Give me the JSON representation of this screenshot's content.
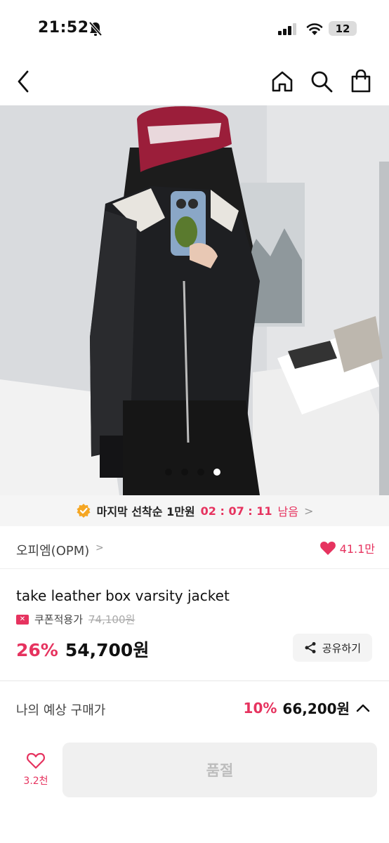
{
  "status_bar": {
    "time": "21:52",
    "battery": "12"
  },
  "nav": {
    "back_icon": "chevron-left-icon",
    "home_icon": "home-icon",
    "search_icon": "search-icon",
    "cart_icon": "shopping-bag-icon"
  },
  "gallery": {
    "total_images": 4,
    "current_index": 4
  },
  "timer_banner": {
    "label": "마지막 선착순 1만원",
    "countdown": "02 : 07 : 11",
    "suffix": "남음",
    "chevron": ">"
  },
  "brand": {
    "name": "오피엠(OPM)",
    "chevron": ">",
    "likes": "41.1만"
  },
  "product": {
    "title": "take leather box varsity jacket",
    "coupon_label": "쿠폰적용가",
    "original_price": "74,100원",
    "discount": "26%",
    "sale_price": "54,700원",
    "share_label": "공유하기"
  },
  "estimate": {
    "label": "나의 예상 구매가",
    "discount": "10%",
    "price": "66,200원"
  },
  "bottom_bar": {
    "likes": "3.2천",
    "buy_label": "품절"
  },
  "colors": {
    "accent": "#e6335f",
    "timer_badge": "#f5a623",
    "soldout_bg": "#f0f0f0"
  }
}
